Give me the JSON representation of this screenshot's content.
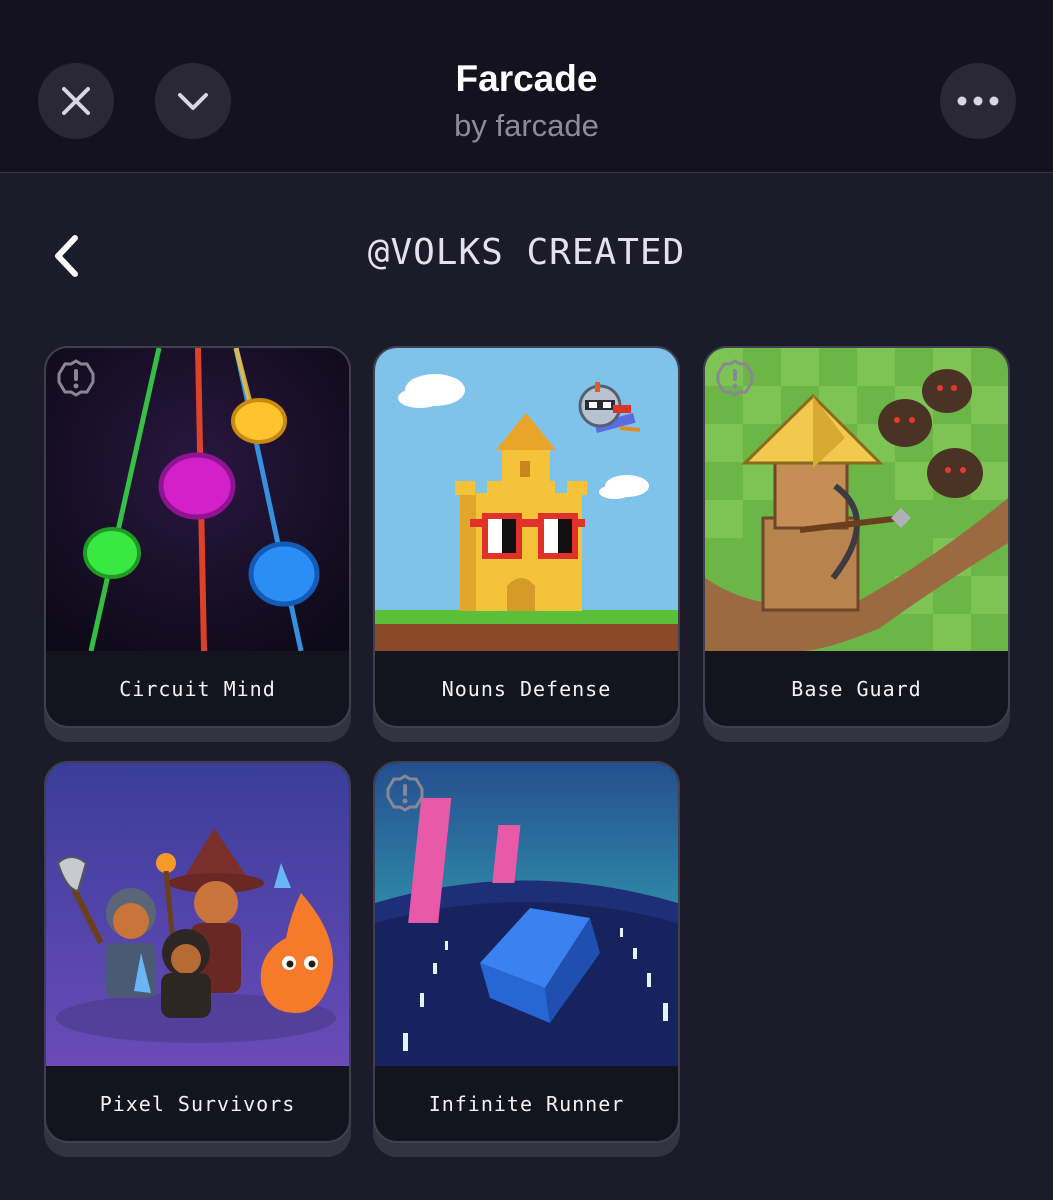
{
  "header": {
    "title": "Farcade",
    "subtitle": "by farcade",
    "close_icon": "close-icon",
    "collapse_icon": "chevron-down-icon",
    "more_icon": "more-horizontal-icon"
  },
  "page": {
    "back_icon": "chevron-left-icon",
    "heading": "@VOLKS CREATED"
  },
  "games": [
    {
      "name": "Circuit Mind",
      "art": "neon-rhythm-lanes",
      "warning": true
    },
    {
      "name": "Nouns Defense",
      "art": "pixel-castle-with-glasses",
      "warning": false
    },
    {
      "name": "Base Guard",
      "art": "crossbow-tower-and-boars",
      "warning": true
    },
    {
      "name": "Pixel Survivors",
      "art": "hero-party",
      "warning": false
    },
    {
      "name": "Infinite Runner",
      "art": "blue-cube-runner",
      "warning": true
    }
  ],
  "colors": {
    "background": "#1b1b2a",
    "header_background": "#15121f",
    "card_background": "#14141f",
    "muted_text": "#8e8a9c"
  }
}
